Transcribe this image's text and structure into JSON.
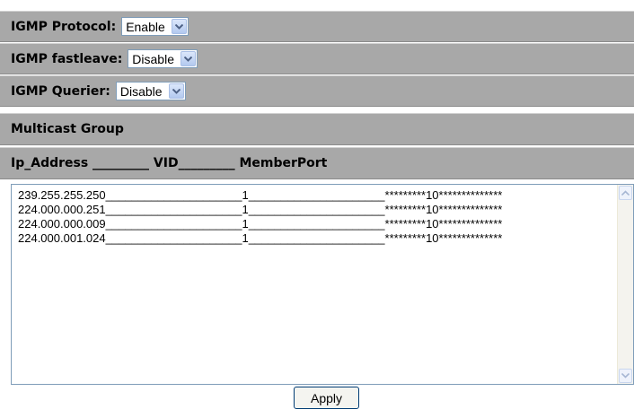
{
  "settings": {
    "protocol": {
      "label": "IGMP Protocol:",
      "value": "Enable"
    },
    "fastleave": {
      "label": "IGMP fastleave:",
      "value": "Disable"
    },
    "querier": {
      "label": "IGMP Querier:",
      "value": "Disable"
    }
  },
  "multicast": {
    "section_title": "Multicast Group",
    "column_header": "Ip_Address _________ VID_________ MemberPort",
    "rows": [
      {
        "ip": "239.255.255.250",
        "vid": "1",
        "ports": "*********10**************"
      },
      {
        "ip": "224.000.000.251",
        "vid": "1",
        "ports": "*********10**************"
      },
      {
        "ip": "224.000.000.009",
        "vid": "1",
        "ports": "*********10**************"
      },
      {
        "ip": "224.000.001.024",
        "vid": "1",
        "ports": "*********10**************"
      }
    ]
  },
  "apply_label": "Apply",
  "icons": {
    "dropdown": "chevron-down-icon",
    "scroll_up": "arrow-up-icon",
    "scroll_down": "arrow-down-icon"
  },
  "colors": {
    "band": "#a8a8a8",
    "accent": "#316ac5"
  }
}
